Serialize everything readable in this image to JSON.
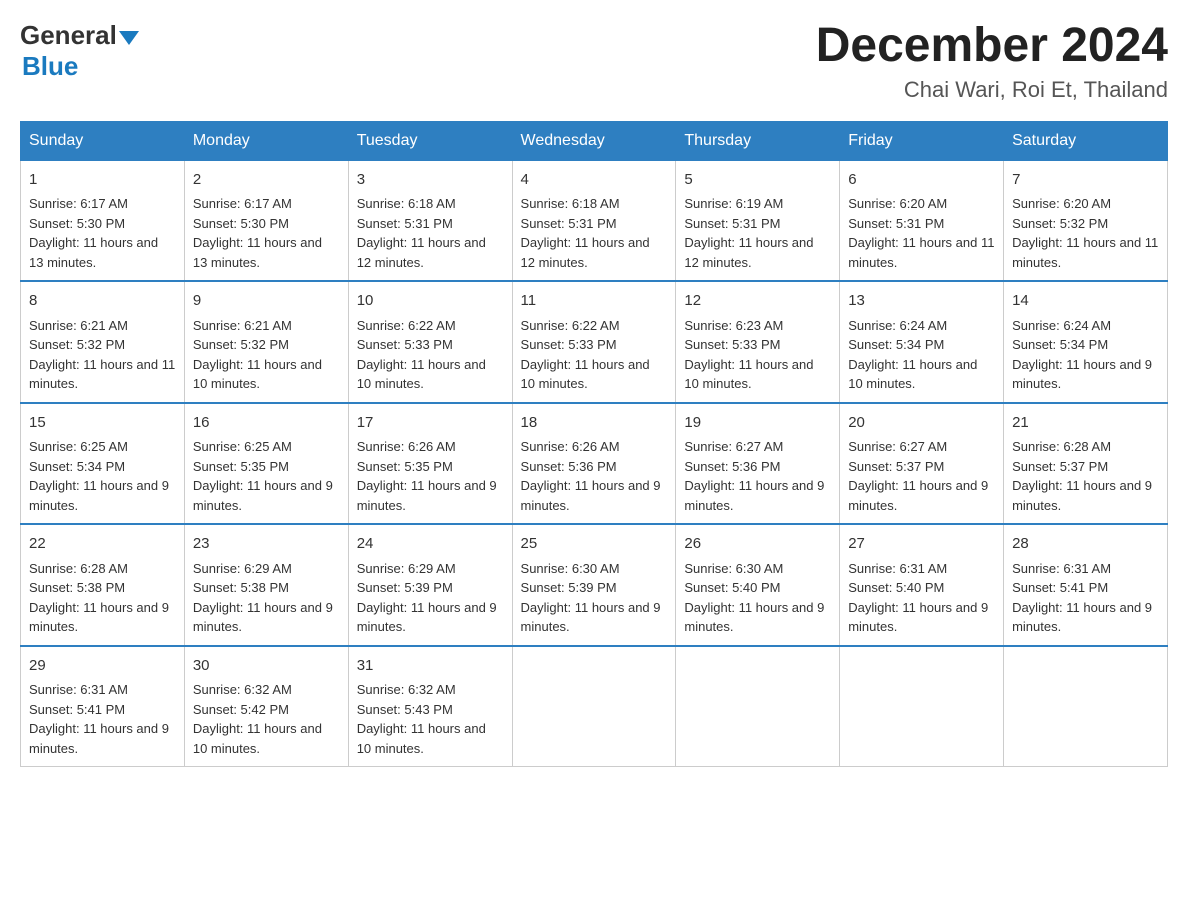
{
  "logo": {
    "general": "General",
    "arrow": "▲",
    "blue": "Blue"
  },
  "title": {
    "month_year": "December 2024",
    "location": "Chai Wari, Roi Et, Thailand"
  },
  "weekdays": [
    "Sunday",
    "Monday",
    "Tuesday",
    "Wednesday",
    "Thursday",
    "Friday",
    "Saturday"
  ],
  "weeks": [
    [
      {
        "day": "1",
        "sunrise": "6:17 AM",
        "sunset": "5:30 PM",
        "daylight": "11 hours and 13 minutes."
      },
      {
        "day": "2",
        "sunrise": "6:17 AM",
        "sunset": "5:30 PM",
        "daylight": "11 hours and 13 minutes."
      },
      {
        "day": "3",
        "sunrise": "6:18 AM",
        "sunset": "5:31 PM",
        "daylight": "11 hours and 12 minutes."
      },
      {
        "day": "4",
        "sunrise": "6:18 AM",
        "sunset": "5:31 PM",
        "daylight": "11 hours and 12 minutes."
      },
      {
        "day": "5",
        "sunrise": "6:19 AM",
        "sunset": "5:31 PM",
        "daylight": "11 hours and 12 minutes."
      },
      {
        "day": "6",
        "sunrise": "6:20 AM",
        "sunset": "5:31 PM",
        "daylight": "11 hours and 11 minutes."
      },
      {
        "day": "7",
        "sunrise": "6:20 AM",
        "sunset": "5:32 PM",
        "daylight": "11 hours and 11 minutes."
      }
    ],
    [
      {
        "day": "8",
        "sunrise": "6:21 AM",
        "sunset": "5:32 PM",
        "daylight": "11 hours and 11 minutes."
      },
      {
        "day": "9",
        "sunrise": "6:21 AM",
        "sunset": "5:32 PM",
        "daylight": "11 hours and 10 minutes."
      },
      {
        "day": "10",
        "sunrise": "6:22 AM",
        "sunset": "5:33 PM",
        "daylight": "11 hours and 10 minutes."
      },
      {
        "day": "11",
        "sunrise": "6:22 AM",
        "sunset": "5:33 PM",
        "daylight": "11 hours and 10 minutes."
      },
      {
        "day": "12",
        "sunrise": "6:23 AM",
        "sunset": "5:33 PM",
        "daylight": "11 hours and 10 minutes."
      },
      {
        "day": "13",
        "sunrise": "6:24 AM",
        "sunset": "5:34 PM",
        "daylight": "11 hours and 10 minutes."
      },
      {
        "day": "14",
        "sunrise": "6:24 AM",
        "sunset": "5:34 PM",
        "daylight": "11 hours and 9 minutes."
      }
    ],
    [
      {
        "day": "15",
        "sunrise": "6:25 AM",
        "sunset": "5:34 PM",
        "daylight": "11 hours and 9 minutes."
      },
      {
        "day": "16",
        "sunrise": "6:25 AM",
        "sunset": "5:35 PM",
        "daylight": "11 hours and 9 minutes."
      },
      {
        "day": "17",
        "sunrise": "6:26 AM",
        "sunset": "5:35 PM",
        "daylight": "11 hours and 9 minutes."
      },
      {
        "day": "18",
        "sunrise": "6:26 AM",
        "sunset": "5:36 PM",
        "daylight": "11 hours and 9 minutes."
      },
      {
        "day": "19",
        "sunrise": "6:27 AM",
        "sunset": "5:36 PM",
        "daylight": "11 hours and 9 minutes."
      },
      {
        "day": "20",
        "sunrise": "6:27 AM",
        "sunset": "5:37 PM",
        "daylight": "11 hours and 9 minutes."
      },
      {
        "day": "21",
        "sunrise": "6:28 AM",
        "sunset": "5:37 PM",
        "daylight": "11 hours and 9 minutes."
      }
    ],
    [
      {
        "day": "22",
        "sunrise": "6:28 AM",
        "sunset": "5:38 PM",
        "daylight": "11 hours and 9 minutes."
      },
      {
        "day": "23",
        "sunrise": "6:29 AM",
        "sunset": "5:38 PM",
        "daylight": "11 hours and 9 minutes."
      },
      {
        "day": "24",
        "sunrise": "6:29 AM",
        "sunset": "5:39 PM",
        "daylight": "11 hours and 9 minutes."
      },
      {
        "day": "25",
        "sunrise": "6:30 AM",
        "sunset": "5:39 PM",
        "daylight": "11 hours and 9 minutes."
      },
      {
        "day": "26",
        "sunrise": "6:30 AM",
        "sunset": "5:40 PM",
        "daylight": "11 hours and 9 minutes."
      },
      {
        "day": "27",
        "sunrise": "6:31 AM",
        "sunset": "5:40 PM",
        "daylight": "11 hours and 9 minutes."
      },
      {
        "day": "28",
        "sunrise": "6:31 AM",
        "sunset": "5:41 PM",
        "daylight": "11 hours and 9 minutes."
      }
    ],
    [
      {
        "day": "29",
        "sunrise": "6:31 AM",
        "sunset": "5:41 PM",
        "daylight": "11 hours and 9 minutes."
      },
      {
        "day": "30",
        "sunrise": "6:32 AM",
        "sunset": "5:42 PM",
        "daylight": "11 hours and 10 minutes."
      },
      {
        "day": "31",
        "sunrise": "6:32 AM",
        "sunset": "5:43 PM",
        "daylight": "11 hours and 10 minutes."
      },
      null,
      null,
      null,
      null
    ]
  ]
}
